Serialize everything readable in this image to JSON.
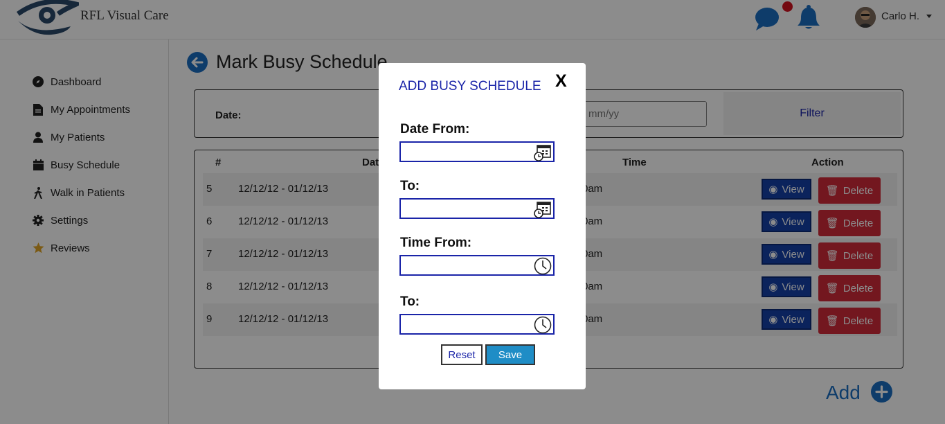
{
  "app": {
    "brand": "RFL Visual Care"
  },
  "header": {
    "user_name": "Carlo H.",
    "icons": [
      "logo-icon",
      "chat-icon",
      "bell-icon",
      "avatar",
      "chevron-down-icon"
    ],
    "colors": {
      "icon_blue": "#1b6ec2",
      "notif": "#d4121f"
    }
  },
  "sidebar": {
    "items": [
      {
        "label": "Dashboard",
        "icon": "compass-icon"
      },
      {
        "label": "My Appointments",
        "icon": "file-icon"
      },
      {
        "label": "My Patients",
        "icon": "user-icon"
      },
      {
        "label": "Busy Schedule",
        "icon": "calendar-icon"
      },
      {
        "label": "Walk in Patients",
        "icon": "walking-icon"
      },
      {
        "label": "Settings",
        "icon": "gear-icon"
      },
      {
        "label": "Reviews",
        "icon": "star-icon"
      }
    ]
  },
  "main": {
    "title": "Mark Busy Schedule",
    "filter": {
      "date_label": "Date:",
      "date_placeholder": "mm/yy",
      "filter_button": "Filter"
    },
    "table": {
      "headers": [
        "#",
        "Date",
        "Time",
        "Action"
      ],
      "rows": [
        {
          "num": "5",
          "date": "12/12/12 - 01/12/13",
          "time": "0am"
        },
        {
          "num": "6",
          "date": "12/12/12 - 01/12/13",
          "time": "0am"
        },
        {
          "num": "7",
          "date": "12/12/12 - 01/12/13",
          "time": "0am"
        },
        {
          "num": "8",
          "date": "12/12/12 - 01/12/13",
          "time": "0am"
        },
        {
          "num": "9",
          "date": "12/12/12 - 01/12/13",
          "time": "0am"
        }
      ],
      "view_label": "View",
      "delete_label": "Delete",
      "colors": {
        "view": "#1541a8",
        "delete": "#d22a3a"
      }
    },
    "add_label": "Add"
  },
  "modal": {
    "title": "ADD BUSY SCHEDULE",
    "close": "X",
    "date_from_label": "Date From:",
    "date_to_label": "To:",
    "time_from_label": "Time From:",
    "time_to_label": "To:",
    "date_from_value": "",
    "date_to_value": "",
    "time_from_value": "",
    "time_to_value": "",
    "reset_label": "Reset",
    "save_label": "Save",
    "colors": {
      "accent": "#1a24a8",
      "save": "#1f8dc6"
    }
  }
}
